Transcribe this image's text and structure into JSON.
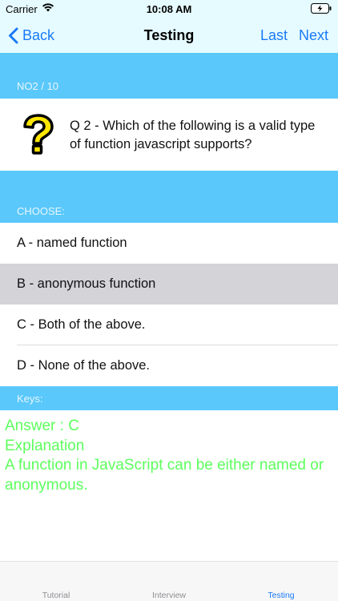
{
  "status_bar": {
    "carrier": "Carrier",
    "time": "10:08 AM"
  },
  "nav": {
    "back_label": "Back",
    "title": "Testing",
    "last_label": "Last",
    "next_label": "Next"
  },
  "progress": {
    "label": "NO2 / 10"
  },
  "question": {
    "icon": "question-mark-icon",
    "text": "Q 2 - Which of the following is a valid type of function javascript supports?"
  },
  "choose_label": "CHOOSE:",
  "options": [
    {
      "label": "A - named function",
      "selected": false
    },
    {
      "label": "B - anonymous function",
      "selected": true
    },
    {
      "label": "C - Both of the above.",
      "selected": false
    },
    {
      "label": "D - None of the above.",
      "selected": false
    }
  ],
  "keys_label": "Keys:",
  "answer": {
    "answer_line": "Answer : C",
    "explanation_title": "Explanation",
    "explanation_text": "A function in JavaScript can be either named or anonymous."
  },
  "tabs": [
    {
      "label": "Tutorial",
      "active": false
    },
    {
      "label": "Interview",
      "active": false
    },
    {
      "label": "Testing",
      "active": true
    }
  ],
  "colors": {
    "accent": "#1a7af7",
    "header_band": "#5ac8fa",
    "answer_text": "#5dff5d",
    "selected_row": "#d3d3d8"
  }
}
